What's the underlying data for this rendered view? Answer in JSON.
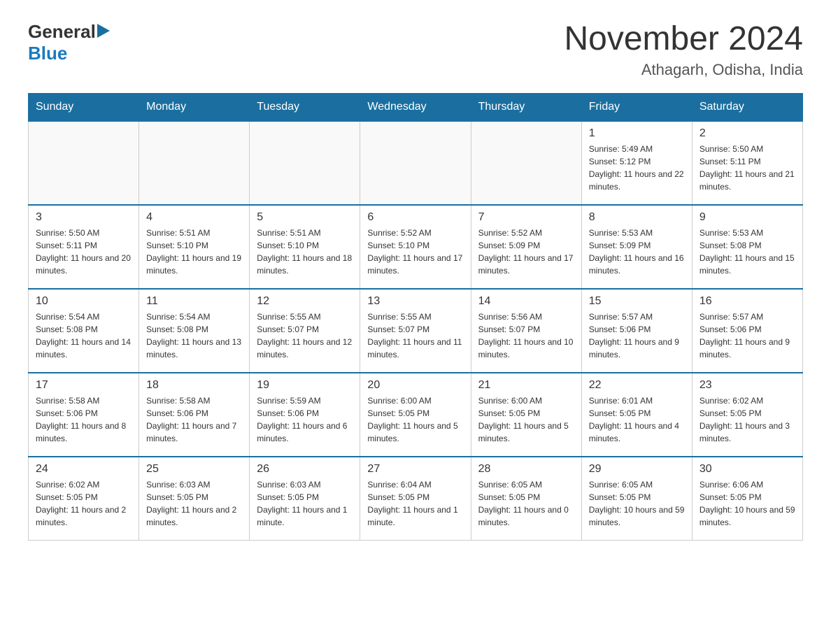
{
  "logo": {
    "general": "General",
    "blue": "Blue"
  },
  "header": {
    "title": "November 2024",
    "subtitle": "Athagarh, Odisha, India"
  },
  "days_of_week": [
    "Sunday",
    "Monday",
    "Tuesday",
    "Wednesday",
    "Thursday",
    "Friday",
    "Saturday"
  ],
  "weeks": [
    [
      {
        "day": "",
        "info": ""
      },
      {
        "day": "",
        "info": ""
      },
      {
        "day": "",
        "info": ""
      },
      {
        "day": "",
        "info": ""
      },
      {
        "day": "",
        "info": ""
      },
      {
        "day": "1",
        "info": "Sunrise: 5:49 AM\nSunset: 5:12 PM\nDaylight: 11 hours and 22 minutes."
      },
      {
        "day": "2",
        "info": "Sunrise: 5:50 AM\nSunset: 5:11 PM\nDaylight: 11 hours and 21 minutes."
      }
    ],
    [
      {
        "day": "3",
        "info": "Sunrise: 5:50 AM\nSunset: 5:11 PM\nDaylight: 11 hours and 20 minutes."
      },
      {
        "day": "4",
        "info": "Sunrise: 5:51 AM\nSunset: 5:10 PM\nDaylight: 11 hours and 19 minutes."
      },
      {
        "day": "5",
        "info": "Sunrise: 5:51 AM\nSunset: 5:10 PM\nDaylight: 11 hours and 18 minutes."
      },
      {
        "day": "6",
        "info": "Sunrise: 5:52 AM\nSunset: 5:10 PM\nDaylight: 11 hours and 17 minutes."
      },
      {
        "day": "7",
        "info": "Sunrise: 5:52 AM\nSunset: 5:09 PM\nDaylight: 11 hours and 17 minutes."
      },
      {
        "day": "8",
        "info": "Sunrise: 5:53 AM\nSunset: 5:09 PM\nDaylight: 11 hours and 16 minutes."
      },
      {
        "day": "9",
        "info": "Sunrise: 5:53 AM\nSunset: 5:08 PM\nDaylight: 11 hours and 15 minutes."
      }
    ],
    [
      {
        "day": "10",
        "info": "Sunrise: 5:54 AM\nSunset: 5:08 PM\nDaylight: 11 hours and 14 minutes."
      },
      {
        "day": "11",
        "info": "Sunrise: 5:54 AM\nSunset: 5:08 PM\nDaylight: 11 hours and 13 minutes."
      },
      {
        "day": "12",
        "info": "Sunrise: 5:55 AM\nSunset: 5:07 PM\nDaylight: 11 hours and 12 minutes."
      },
      {
        "day": "13",
        "info": "Sunrise: 5:55 AM\nSunset: 5:07 PM\nDaylight: 11 hours and 11 minutes."
      },
      {
        "day": "14",
        "info": "Sunrise: 5:56 AM\nSunset: 5:07 PM\nDaylight: 11 hours and 10 minutes."
      },
      {
        "day": "15",
        "info": "Sunrise: 5:57 AM\nSunset: 5:06 PM\nDaylight: 11 hours and 9 minutes."
      },
      {
        "day": "16",
        "info": "Sunrise: 5:57 AM\nSunset: 5:06 PM\nDaylight: 11 hours and 9 minutes."
      }
    ],
    [
      {
        "day": "17",
        "info": "Sunrise: 5:58 AM\nSunset: 5:06 PM\nDaylight: 11 hours and 8 minutes."
      },
      {
        "day": "18",
        "info": "Sunrise: 5:58 AM\nSunset: 5:06 PM\nDaylight: 11 hours and 7 minutes."
      },
      {
        "day": "19",
        "info": "Sunrise: 5:59 AM\nSunset: 5:06 PM\nDaylight: 11 hours and 6 minutes."
      },
      {
        "day": "20",
        "info": "Sunrise: 6:00 AM\nSunset: 5:05 PM\nDaylight: 11 hours and 5 minutes."
      },
      {
        "day": "21",
        "info": "Sunrise: 6:00 AM\nSunset: 5:05 PM\nDaylight: 11 hours and 5 minutes."
      },
      {
        "day": "22",
        "info": "Sunrise: 6:01 AM\nSunset: 5:05 PM\nDaylight: 11 hours and 4 minutes."
      },
      {
        "day": "23",
        "info": "Sunrise: 6:02 AM\nSunset: 5:05 PM\nDaylight: 11 hours and 3 minutes."
      }
    ],
    [
      {
        "day": "24",
        "info": "Sunrise: 6:02 AM\nSunset: 5:05 PM\nDaylight: 11 hours and 2 minutes."
      },
      {
        "day": "25",
        "info": "Sunrise: 6:03 AM\nSunset: 5:05 PM\nDaylight: 11 hours and 2 minutes."
      },
      {
        "day": "26",
        "info": "Sunrise: 6:03 AM\nSunset: 5:05 PM\nDaylight: 11 hours and 1 minute."
      },
      {
        "day": "27",
        "info": "Sunrise: 6:04 AM\nSunset: 5:05 PM\nDaylight: 11 hours and 1 minute."
      },
      {
        "day": "28",
        "info": "Sunrise: 6:05 AM\nSunset: 5:05 PM\nDaylight: 11 hours and 0 minutes."
      },
      {
        "day": "29",
        "info": "Sunrise: 6:05 AM\nSunset: 5:05 PM\nDaylight: 10 hours and 59 minutes."
      },
      {
        "day": "30",
        "info": "Sunrise: 6:06 AM\nSunset: 5:05 PM\nDaylight: 10 hours and 59 minutes."
      }
    ]
  ]
}
